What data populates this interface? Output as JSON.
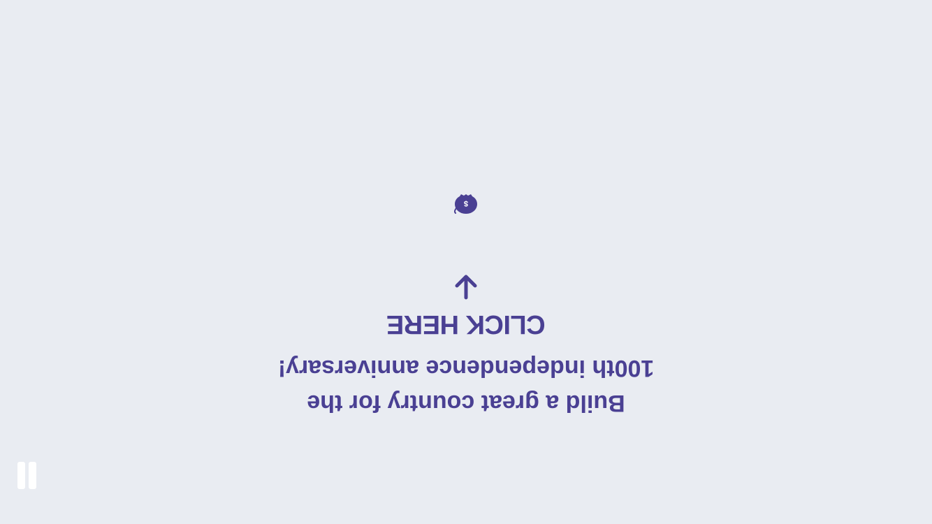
{
  "prompt": {
    "click_label": "CLICK HERE",
    "tagline_line1": "Build a great country for the",
    "tagline_line2": "100th independence anniversary!"
  },
  "icons": {
    "coin": "money-bag-icon",
    "arrow": "arrow-up-icon",
    "pause": "pause-icon"
  },
  "colors": {
    "background": "#e9ecf2",
    "accent": "#4a4093",
    "pause": "#ffffff"
  }
}
